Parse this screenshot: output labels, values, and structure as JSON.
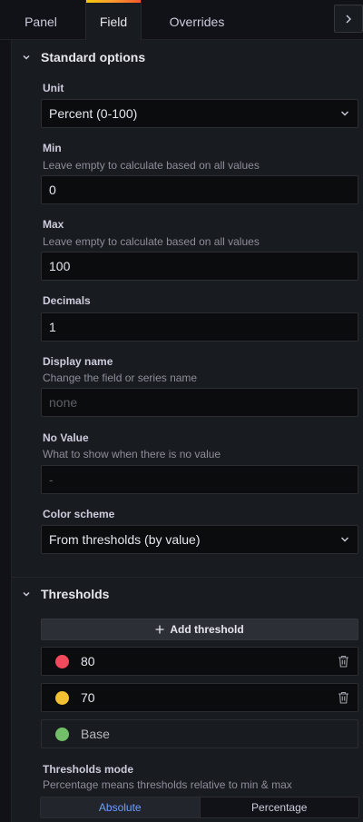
{
  "tabs": [
    {
      "label": "Panel"
    },
    {
      "label": "Field"
    },
    {
      "label": "Overrides"
    }
  ],
  "active_tab": "Field",
  "standard_options": {
    "title": "Standard options",
    "unit": {
      "label": "Unit",
      "value": "Percent (0-100)"
    },
    "min": {
      "label": "Min",
      "description": "Leave empty to calculate based on all values",
      "value": "0"
    },
    "max": {
      "label": "Max",
      "description": "Leave empty to calculate based on all values",
      "value": "100"
    },
    "decimals": {
      "label": "Decimals",
      "value": "1"
    },
    "display_name": {
      "label": "Display name",
      "description": "Change the field or series name",
      "placeholder": "none"
    },
    "no_value": {
      "label": "No Value",
      "description": "What to show when there is no value",
      "placeholder": "-"
    },
    "color_scheme": {
      "label": "Color scheme",
      "value": "From thresholds (by value)"
    }
  },
  "thresholds": {
    "title": "Thresholds",
    "add_label": "Add threshold",
    "steps": [
      {
        "value": "80",
        "color": "#f2495c",
        "deletable": true
      },
      {
        "value": "70",
        "color": "#fade2a",
        "deletable": true
      },
      {
        "value": "Base",
        "color": "#73bf69",
        "deletable": false
      }
    ],
    "mode": {
      "label": "Thresholds mode",
      "description": "Percentage means thresholds relative to min & max",
      "options": [
        "Absolute",
        "Percentage"
      ],
      "selected": "Absolute"
    }
  },
  "colors": {
    "accent": "#6e9fff",
    "tab_highlight": "#ff9830"
  }
}
